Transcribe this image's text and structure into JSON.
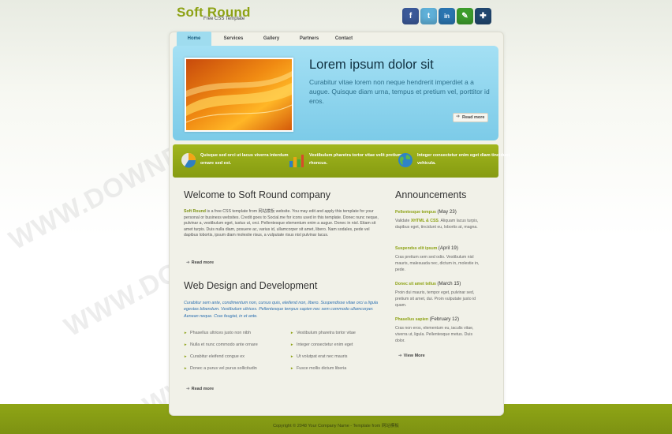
{
  "header": {
    "logo_title": "Soft Round",
    "logo_subtitle": "Free CSS Template",
    "social": [
      {
        "icon": "facebook-icon",
        "glyph": "f",
        "color": "#3b5998"
      },
      {
        "icon": "twitter-icon",
        "glyph": "t",
        "color": "#5fb0d8"
      },
      {
        "icon": "linkedin-icon",
        "glyph": "in",
        "color": "#2a75b0"
      },
      {
        "icon": "talk-icon",
        "glyph": "✎",
        "color": "#3d9c2c"
      },
      {
        "icon": "myspace-icon",
        "glyph": "✚",
        "color": "#21476f"
      }
    ]
  },
  "nav": {
    "tabs": [
      "Home",
      "Services",
      "Gallery",
      "Partners",
      "Contact"
    ]
  },
  "hero": {
    "title": "Lorem ipsum dolor sit",
    "text": "Curabitur vitae lorem non neque hendrerit imperdiet a a augue. Quisque diam urna, tempus et pretium vel, porttitor id eros.",
    "button": "Read more"
  },
  "features": [
    {
      "icon": "pie-chart-icon",
      "text": "Quisque sed orci ut lacus viverra interdum ornare sed est."
    },
    {
      "icon": "bar-chart-icon",
      "text": "Vestibulum pharetra tortor vitae velit pretium rhoncus."
    },
    {
      "icon": "globe-icon",
      "text": "Integer consectetur enim eget diam tincidunt vehicula."
    }
  ],
  "welcome": {
    "title": "Welcome to Soft Round company",
    "lead": "Soft Round",
    "text": "is a free CSS template from 网站模板 website. You may edit and apply this template for your personal or business websites. Credit goes to Social.me for icons used in this template. Donec nunc neque, pulvinar a, vestibulum eget, iustus ut, orci. Pellentesque elementum enim a augue. Donec in nisl. Etiam sit amet turpis. Duis nulla diam, posuere ac, varius id, ullamcorper sit amet, libero. Nam sodales, pede vel dapibus lobortis, ipsum diam molestie risus, a vulputate risus nisl pulvinar lacus.",
    "button": "Read more"
  },
  "webdesign": {
    "title": "Web Design and Development",
    "quote": "Curabitur sem ante, condimentum non, cursus quis, eleifend non, libero. Suspendisse vitae orci a ligula egestas bibendum. Vestibulum ultrices. Pellentesque tempus sapien nec sem commodo ullamcorper. Aenean neque. Cras feugiat, in et ante.",
    "list_left": [
      "Phasellus ultrices justo non nibh",
      "Nulla et nunc commodo ante ornare",
      "Curabitur eleifend congue ex",
      "Donec a purus vel purus sollicitudin"
    ],
    "list_right": [
      "Vestibulum pharetra tortor vitae",
      "Integer consectetur enim eget",
      "Ut volutpat erat nec mauris",
      "Fusce mollis dictum liberia"
    ],
    "button": "Read more"
  },
  "announcements": {
    "title": "Announcements",
    "items": [
      {
        "headline": "Pellentesque tempus",
        "date": "(May 23)",
        "text_before": "Validate",
        "text_highlight": "XHTML & CSS",
        "text_after": ". Aliquam lacus turpis, dapibus eget, tincidunt eu, lobortis at, magna."
      },
      {
        "headline": "Suspendss elit ipsum",
        "date": "(April 19)",
        "text_before": "Cras pretium sem sed odio. Vestibulum nisl mauris, malesuada nec, dictum in, molestie in, pede.",
        "text_highlight": "",
        "text_after": ""
      },
      {
        "headline": "Donec sit amet tellus",
        "date": "(March 15)",
        "text_before": "Proin dui mauris, tempor eget, pulvinar sed, pretium sit amet, dui. Proin vulputate justo id quam.",
        "text_highlight": "",
        "text_after": ""
      },
      {
        "headline": "Phasellus sapien",
        "date": "(February 12)",
        "text_before": "Cras non eros, elementum eu, iaculis vitae, viverra ut, ligula. Pellentesque metus. Duis dolor.",
        "text_highlight": "",
        "text_after": ""
      }
    ],
    "view_more": "View More"
  },
  "footer": {
    "text": "Copyright © 2048 Your Company Name - Template from 网站模板"
  },
  "watermark": "WWW.DOWNDEMO.COM",
  "colors": {
    "accent_green": "#8da214",
    "hero_blue": "#8fd4ee",
    "link_blue": "#2b6fb0"
  }
}
